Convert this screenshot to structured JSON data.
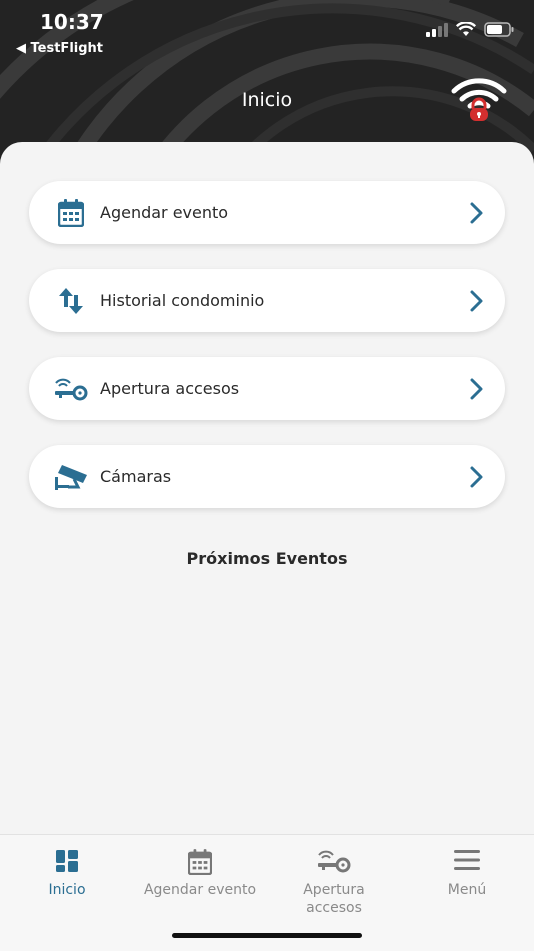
{
  "status_bar": {
    "time": "10:37",
    "back_app": "◀ TestFlight"
  },
  "header": {
    "title": "Inicio"
  },
  "menu": {
    "items": [
      {
        "label": "Agendar evento",
        "icon": "calendar-icon"
      },
      {
        "label": "Historial condominio",
        "icon": "up-down-arrows-icon"
      },
      {
        "label": "Apertura accesos",
        "icon": "wireless-key-icon"
      },
      {
        "label": "Cámaras",
        "icon": "security-camera-icon"
      }
    ]
  },
  "events": {
    "section_title": "Próximos Eventos"
  },
  "tabbar": {
    "tabs": [
      {
        "label": "Inicio",
        "icon": "dashboard-grid-icon",
        "active": true
      },
      {
        "label": "Agendar evento",
        "icon": "calendar-icon",
        "active": false
      },
      {
        "label": "Apertura accesos",
        "icon": "wireless-key-icon",
        "active": false
      },
      {
        "label": "Menú",
        "icon": "hamburger-icon",
        "active": false
      }
    ]
  },
  "colors": {
    "accent": "#2b6e92",
    "header_bg": "#232323",
    "logo_lock": "#d32f2f"
  }
}
